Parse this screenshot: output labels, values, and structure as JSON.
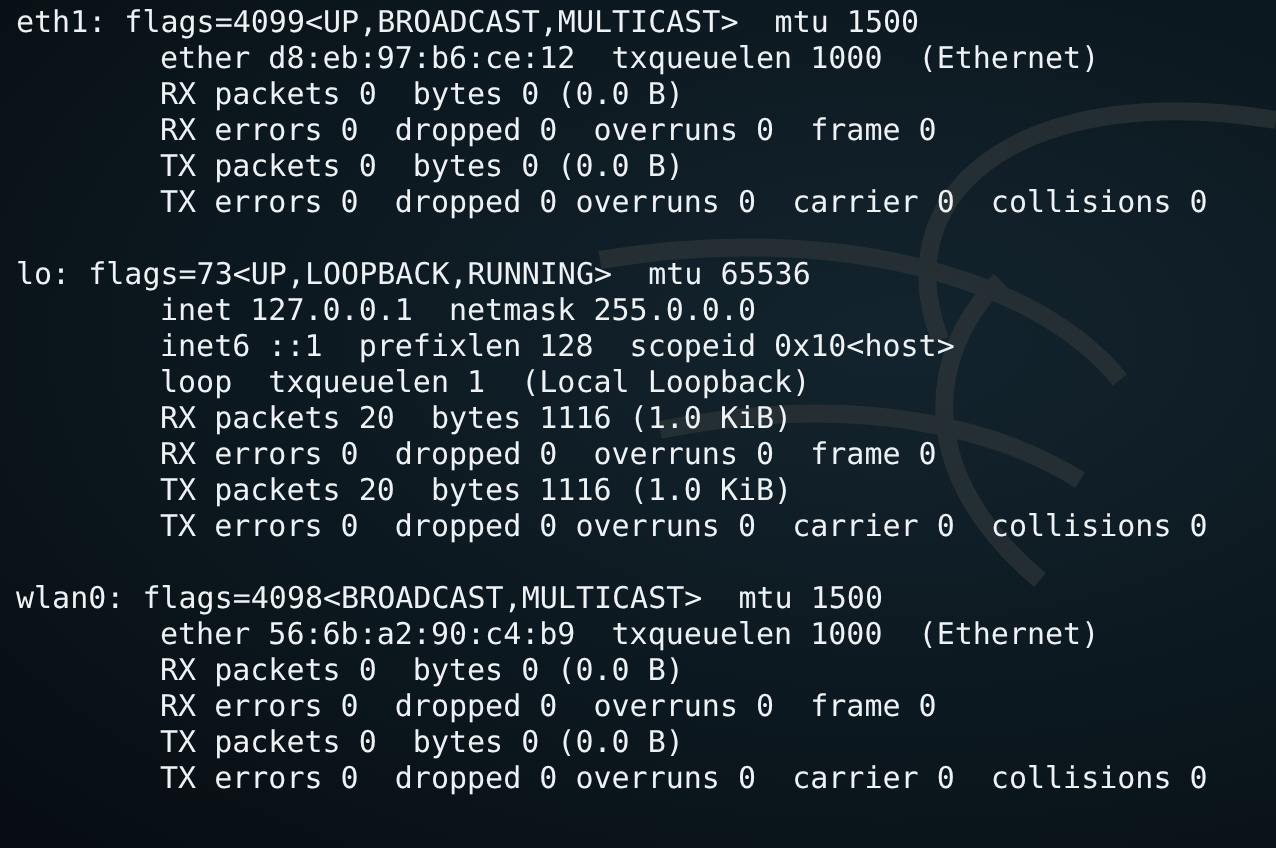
{
  "interfaces": [
    {
      "header": "eth1: flags=4099<UP,BROADCAST,MULTICAST>  mtu 1500",
      "lines": [
        "ether d8:eb:97:b6:ce:12  txqueuelen 1000  (Ethernet)",
        "RX packets 0  bytes 0 (0.0 B)",
        "RX errors 0  dropped 0  overruns 0  frame 0",
        "TX packets 0  bytes 0 (0.0 B)",
        "TX errors 0  dropped 0 overruns 0  carrier 0  collisions 0"
      ]
    },
    {
      "header": "lo: flags=73<UP,LOOPBACK,RUNNING>  mtu 65536",
      "lines": [
        "inet 127.0.0.1  netmask 255.0.0.0",
        "inet6 ::1  prefixlen 128  scopeid 0x10<host>",
        "loop  txqueuelen 1  (Local Loopback)",
        "RX packets 20  bytes 1116 (1.0 KiB)",
        "RX errors 0  dropped 0  overruns 0  frame 0",
        "TX packets 20  bytes 1116 (1.0 KiB)",
        "TX errors 0  dropped 0 overruns 0  carrier 0  collisions 0"
      ]
    },
    {
      "header": "wlan0: flags=4098<BROADCAST,MULTICAST>  mtu 1500",
      "lines": [
        "ether 56:6b:a2:90:c4:b9  txqueuelen 1000  (Ethernet)",
        "RX packets 0  bytes 0 (0.0 B)",
        "RX errors 0  dropped 0  overruns 0  frame 0",
        "TX packets 0  bytes 0 (0.0 B)",
        "TX errors 0  dropped 0 overruns 0  carrier 0  collisions 0"
      ]
    }
  ]
}
